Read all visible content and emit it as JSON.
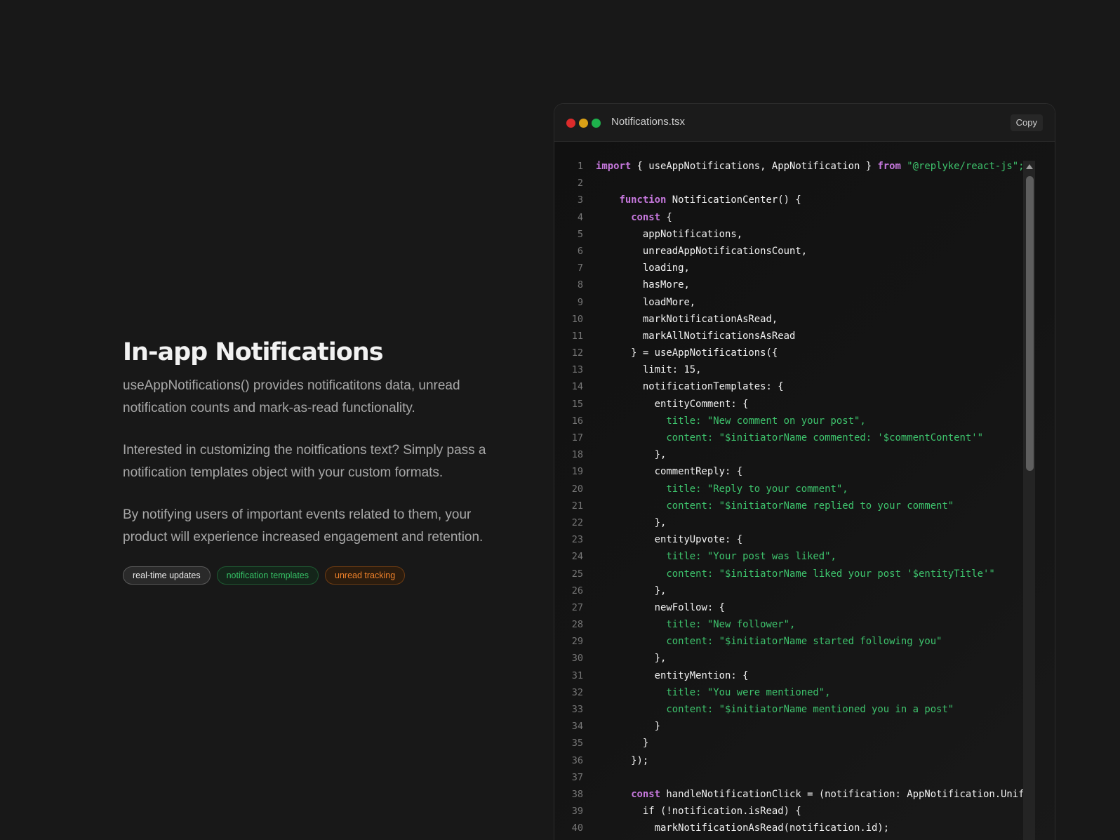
{
  "section": {
    "title": "In-app Notifications",
    "paragraphs": [
      "useAppNotifications() provides notificatitons data, unread notification counts and mark-as-read functionality.",
      "Interested in customizing the noitfications text? Simply pass a notification templates object with your custom formats.",
      "By notifying users of important events related to them, your product will experience increased engagement and retention."
    ],
    "tags": [
      "real-time updates",
      "notification templates",
      "unread tracking"
    ]
  },
  "editor": {
    "filename": "Notifications.tsx",
    "copy_label": "Copy",
    "window_dots": [
      "close",
      "minimize",
      "maximize"
    ],
    "colors": {
      "keyword": "#c678dd",
      "string": "#3ec46d",
      "text": "#f2f2f2",
      "line_number": "#777777"
    },
    "lines": [
      [
        [
          "kw",
          "import"
        ],
        [
          "p",
          " { useAppNotifications, AppNotification } "
        ],
        [
          "kw",
          "from"
        ],
        [
          "p",
          " "
        ],
        [
          "str",
          "\"@replyke/react-js\";"
        ]
      ],
      [],
      [
        [
          "p",
          "    "
        ],
        [
          "kw",
          "function"
        ],
        [
          "p",
          " NotificationCenter() {"
        ]
      ],
      [
        [
          "p",
          "      "
        ],
        [
          "kw",
          "const"
        ],
        [
          "p",
          " {"
        ]
      ],
      [
        [
          "p",
          "        appNotifications,"
        ]
      ],
      [
        [
          "p",
          "        unreadAppNotificationsCount,"
        ]
      ],
      [
        [
          "p",
          "        loading,"
        ]
      ],
      [
        [
          "p",
          "        hasMore,"
        ]
      ],
      [
        [
          "p",
          "        loadMore,"
        ]
      ],
      [
        [
          "p",
          "        markNotificationAsRead,"
        ]
      ],
      [
        [
          "p",
          "        markAllNotificationsAsRead"
        ]
      ],
      [
        [
          "p",
          "      } = useAppNotifications({"
        ]
      ],
      [
        [
          "p",
          "        limit: 15,"
        ]
      ],
      [
        [
          "p",
          "        notificationTemplates: {"
        ]
      ],
      [
        [
          "p",
          "          entityComment: {"
        ]
      ],
      [
        [
          "p",
          "            "
        ],
        [
          "str",
          "title: \"New comment on your post\","
        ]
      ],
      [
        [
          "p",
          "            "
        ],
        [
          "str",
          "content: \"$initiatorName commented: '$commentContent'\""
        ]
      ],
      [
        [
          "p",
          "          },"
        ]
      ],
      [
        [
          "p",
          "          commentReply: {"
        ]
      ],
      [
        [
          "p",
          "            "
        ],
        [
          "str",
          "title: \"Reply to your comment\","
        ]
      ],
      [
        [
          "p",
          "            "
        ],
        [
          "str",
          "content: \"$initiatorName replied to your comment\""
        ]
      ],
      [
        [
          "p",
          "          },"
        ]
      ],
      [
        [
          "p",
          "          entityUpvote: {"
        ]
      ],
      [
        [
          "p",
          "            "
        ],
        [
          "str",
          "title: \"Your post was liked\","
        ]
      ],
      [
        [
          "p",
          "            "
        ],
        [
          "str",
          "content: \"$initiatorName liked your post '$entityTitle'\""
        ]
      ],
      [
        [
          "p",
          "          },"
        ]
      ],
      [
        [
          "p",
          "          newFollow: {"
        ]
      ],
      [
        [
          "p",
          "            "
        ],
        [
          "str",
          "title: \"New follower\","
        ]
      ],
      [
        [
          "p",
          "            "
        ],
        [
          "str",
          "content: \"$initiatorName started following you\""
        ]
      ],
      [
        [
          "p",
          "          },"
        ]
      ],
      [
        [
          "p",
          "          entityMention: {"
        ]
      ],
      [
        [
          "p",
          "            "
        ],
        [
          "str",
          "title: \"You were mentioned\","
        ]
      ],
      [
        [
          "p",
          "            "
        ],
        [
          "str",
          "content: \"$initiatorName mentioned you in a post\""
        ]
      ],
      [
        [
          "p",
          "          }"
        ]
      ],
      [
        [
          "p",
          "        }"
        ]
      ],
      [
        [
          "p",
          "      });"
        ]
      ],
      [],
      [
        [
          "p",
          "      "
        ],
        [
          "kw",
          "const"
        ],
        [
          "p",
          " handleNotificationClick = (notification: AppNotification.Unifi"
        ]
      ],
      [
        [
          "p",
          "        if (!notification.isRead) {"
        ]
      ],
      [
        [
          "p",
          "          markNotificationAsRead(notification.id);"
        ]
      ]
    ]
  }
}
